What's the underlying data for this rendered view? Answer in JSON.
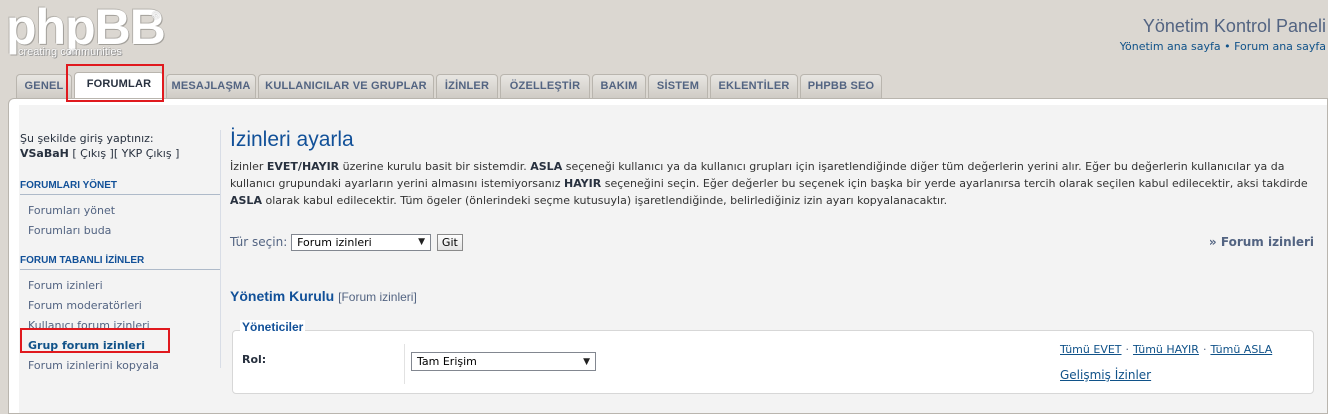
{
  "logo": {
    "word": "phpBB",
    "tagline": "creating communities",
    "reg": "®"
  },
  "header": {
    "title": "Yönetim Kontrol Paneli",
    "links": "Yönetim ana sayfa • Forum ana sayfa"
  },
  "tabs": [
    {
      "label": "GENEL",
      "active": false
    },
    {
      "label": "FORUMLAR",
      "active": true
    },
    {
      "label": "MESAJLAŞMA",
      "active": false
    },
    {
      "label": "KULLANICILAR VE GRUPLAR",
      "active": false
    },
    {
      "label": "İZİNLER",
      "active": false
    },
    {
      "label": "ÖZELLEŞTİR",
      "active": false
    },
    {
      "label": "BAKIM",
      "active": false
    },
    {
      "label": "SİSTEM",
      "active": false
    },
    {
      "label": "EKLENTİLER",
      "active": false
    },
    {
      "label": "PHPBB SEO",
      "active": false
    }
  ],
  "sidebar": {
    "login_label": "Şu şekilde giriş yaptınız:",
    "username": "VSaBaH",
    "logout_links": " [ Çıkış ][ YKP Çıkış ]",
    "sections": [
      {
        "title": "FORUMLARI YÖNET",
        "items": [
          "Forumları yönet",
          "Forumları buda"
        ]
      },
      {
        "title": "FORUM TABANLI İZİNLER",
        "items": [
          "Forum izinleri",
          "Forum moderatörleri",
          "Kullanıcı forum izinleri",
          "Grup forum izinleri",
          "Forum izinlerini kopyala"
        ],
        "active_index": 3
      }
    ]
  },
  "content": {
    "title": "İzinleri ayarla",
    "intro_parts": [
      "İzinler ",
      "EVET/HAYIR",
      " üzerine kurulu basit bir sistemdir. ",
      "ASLA",
      " seçeneği kullanıcı ya da kullanıcı grupları için işaretlendiğinde diğer tüm değerlerin yerini alır. Eğer bu değerlerin kullanıcılar ya da kullanıcı grupundaki ayarların yerini almasını istemiyorsanız ",
      "HAYIR",
      " seçeneğini seçin. Eğer değerler bu seçenek için başka bir yerde ayarlanırsa tercih olarak seçilen kabul edilecektir, aksi takdirde ",
      "ASLA",
      " olarak kabul edilecektir. Tüm ögeler (önlerindeki seçme kutusuyla) işaretlendiğinde, belirlediğiniz izin ayarı kopyalanacaktır."
    ],
    "type_label": "Tür seçin:",
    "type_value": "Forum izinleri",
    "go_label": "Git",
    "right_crumb": "Forum izinleri",
    "admin_board": "Yönetim Kurulu",
    "admin_board_sub": "[Forum izinleri]",
    "legend": "Yöneticiler",
    "role_label": "Rol:",
    "role_value": "Tam Erişim",
    "all_yes": "Tümü EVET",
    "all_no": "Tümü HAYIR",
    "all_never": "Tümü ASLA",
    "advanced": "Gelişmiş İzinler"
  },
  "highlight_color": "#e0191e"
}
